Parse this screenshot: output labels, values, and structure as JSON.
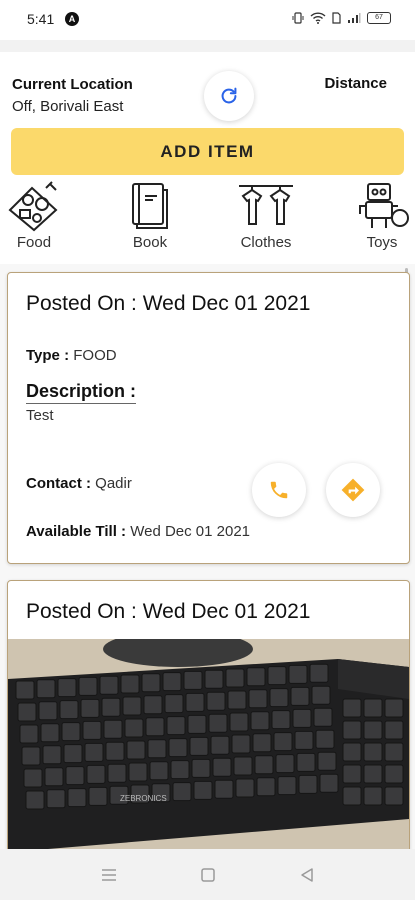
{
  "status_bar": {
    "time": "5:41",
    "badge": "A",
    "battery": "67"
  },
  "header": {
    "location_title": "Current Location",
    "location_value": "Off, Borivali East",
    "distance_label": "Distance",
    "add_item_label": "ADD ITEM",
    "categories": [
      {
        "label": "Food",
        "icon": "food-icon"
      },
      {
        "label": "Book",
        "icon": "book-icon"
      },
      {
        "label": "Clothes",
        "icon": "clothes-icon"
      },
      {
        "label": "Toys",
        "icon": "toys-icon"
      }
    ]
  },
  "posts": [
    {
      "posted_on": "Posted On : Wed Dec 01 2021",
      "type_label": "Type :",
      "type_value": "FOOD",
      "description_label": "Description :",
      "description_value": "Test",
      "contact_label": "Contact :",
      "contact_value": "Qadir",
      "available_label": "Available Till :",
      "available_value": "Wed Dec 01 2021"
    },
    {
      "posted_on": "Posted On : Wed Dec 01 2021",
      "photo_brand": "ZEBRONICS"
    }
  ],
  "colors": {
    "accent": "#fbd96b",
    "icon_orange": "#f7b02a",
    "card_border": "#b9a27a",
    "refresh_blue": "#2a63e8"
  }
}
